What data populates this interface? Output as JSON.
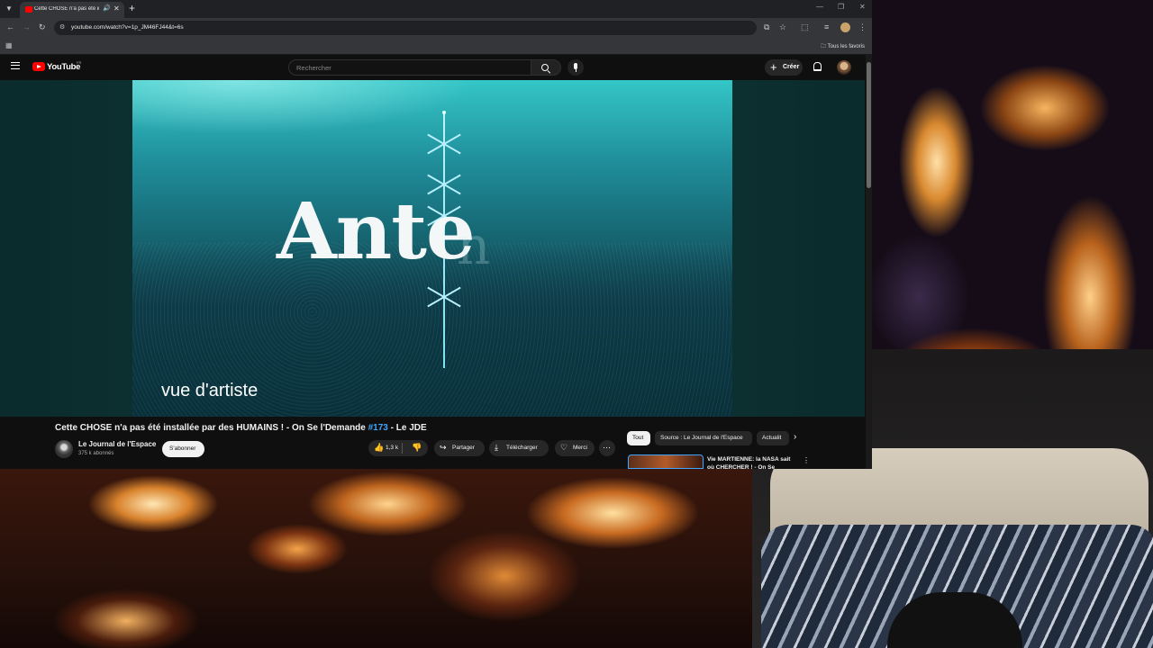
{
  "browser": {
    "tab_title": "Cette CHOSE n'a pas été installée par des HUMAINS",
    "url": "youtube.com/watch?v=1p_JM46FJ44&t=6s",
    "bookmarks_folder": "Tous les favoris"
  },
  "youtube": {
    "logo_text": "YouTube",
    "region": "FR",
    "search_placeholder": "Rechercher",
    "create_label": "Créer",
    "video": {
      "overlay_word": "Ante",
      "overlay_ghost": "n",
      "subtitle": "vue d'artiste"
    },
    "title_main": "Cette CHOSE n'a pas été installée par des HUMAINS ! - On Se l'Demande ",
    "title_hashtag": "#173",
    "title_end": " - Le JDE",
    "channel": {
      "name": "Le Journal de l'Espace",
      "subscribers": "375 k abonnés",
      "subscribe_label": "S'abonner"
    },
    "actions": {
      "likes": "1,3 k",
      "share": "Partager",
      "download": "Télécharger",
      "thanks": "Merci"
    },
    "chips": [
      "Tout",
      "Source : Le Journal de l'Espace",
      "Actualit"
    ],
    "recommendation": {
      "title": "Vie MARTIENNE: la NASA sait où CHERCHER ! - On Se"
    }
  }
}
